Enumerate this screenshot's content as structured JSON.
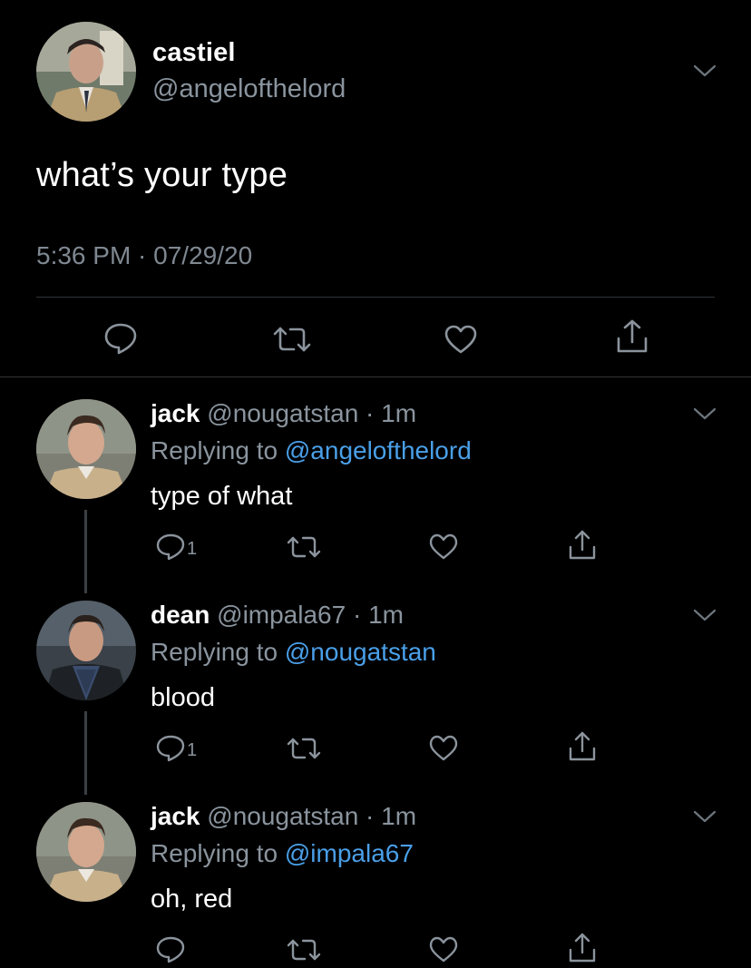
{
  "main_tweet": {
    "name": "castiel",
    "handle": "@angelofthelord",
    "text": "what’s your type",
    "timestamp": "5:36 PM · 07/29/20",
    "actions": [
      "reply-icon",
      "retweet-icon",
      "like-icon",
      "share-icon"
    ]
  },
  "replies": [
    {
      "name": "jack",
      "handle": "@nougatstan",
      "age": "1m",
      "replying_label": "Replying to",
      "replying_to": "@angelofthelord",
      "text": "type of what",
      "reply_count": "1"
    },
    {
      "name": "dean",
      "handle": "@impala67",
      "age": "1m",
      "replying_label": "Replying to",
      "replying_to": "@nougatstan",
      "text": "blood",
      "reply_count": "1"
    },
    {
      "name": "jack",
      "handle": "@nougatstan",
      "age": "1m",
      "replying_label": "Replying to",
      "replying_to": "@impala67",
      "text": "oh, red",
      "reply_count": ""
    }
  ],
  "colors": {
    "background": "#000000",
    "secondary_text": "#8a949e",
    "mention": "#4a9fe8",
    "divider": "#2f3336"
  }
}
